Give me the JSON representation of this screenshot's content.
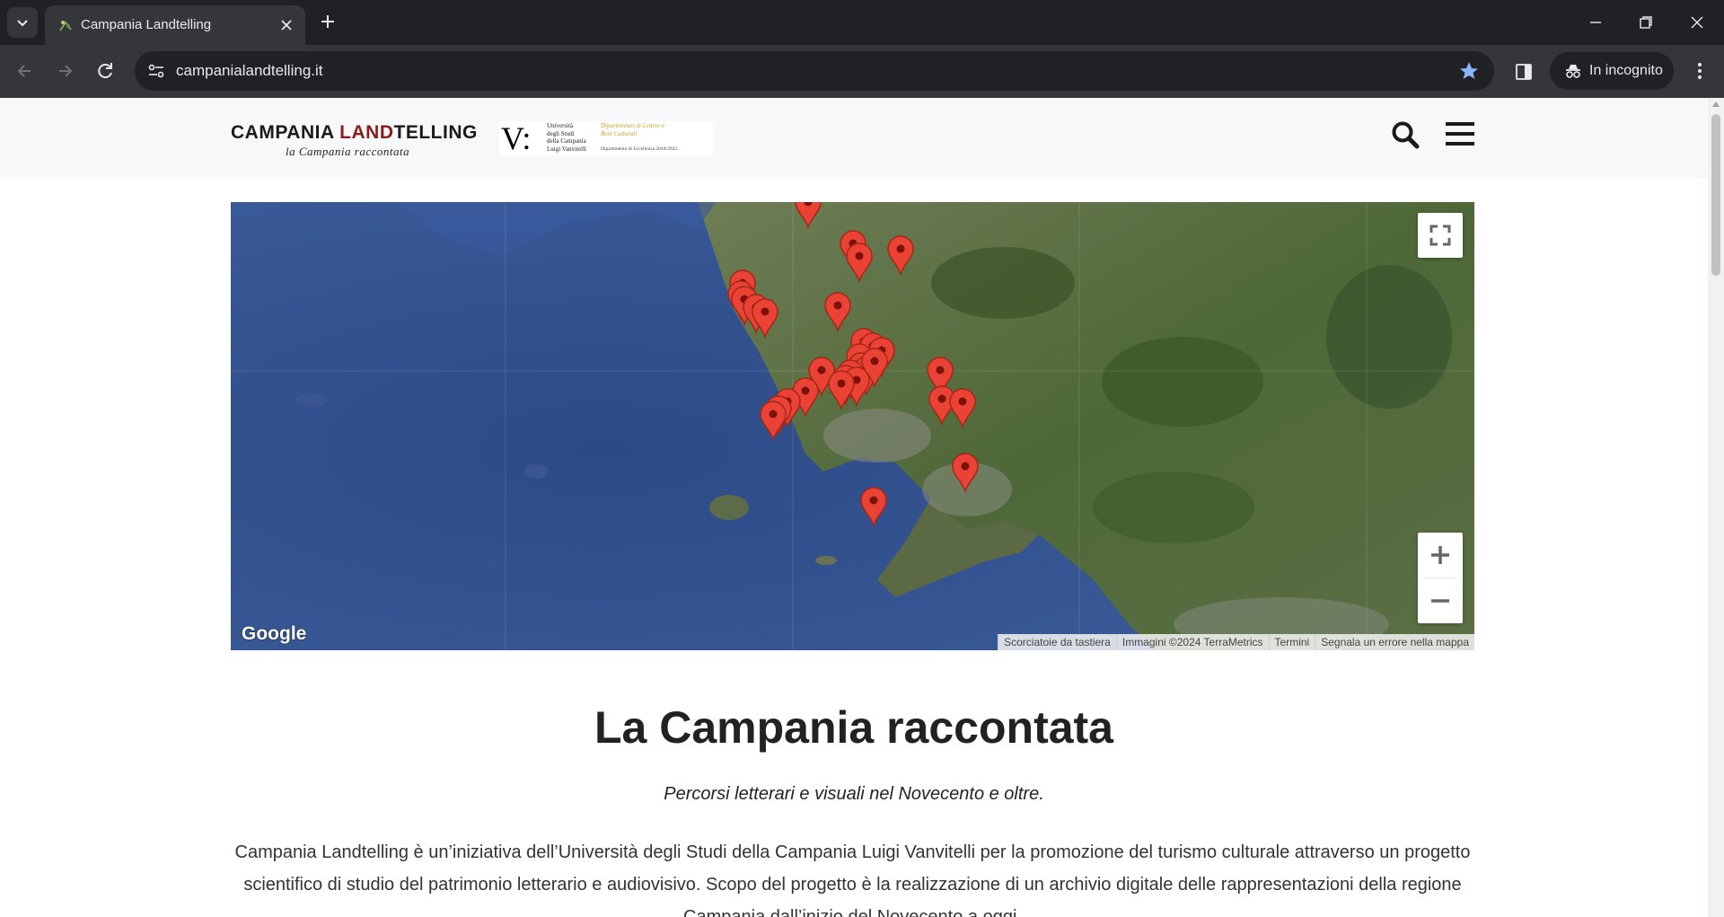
{
  "browser": {
    "tab_title": "Campania Landtelling",
    "url": "campanialandtelling.it",
    "incognito_label": "In incognito"
  },
  "header": {
    "logo_part1": "CAMPANIA ",
    "logo_accent": "LAND",
    "logo_part2": "TELLING",
    "logo_tagline": "la Campania raccontata",
    "uni_mark": "V:",
    "uni_text": "Università\ndegli Studi\ndella Campania\nLuigi Vanvitelli",
    "uni_dept": "Dipartimento di Lettere e\nBeni Culturali",
    "uni_excellence": "Dipartimento di Eccellenza 2018/2022"
  },
  "map": {
    "google_label": "Google",
    "attribution": [
      "Scorciatoie da tastiera",
      "Immagini ©2024 TerraMetrics",
      "Termini",
      "Segnala un errore nella mappa"
    ]
  },
  "content": {
    "title": "La Campania raccontata",
    "subtitle": "Percorsi letterari e visuali nel Novecento e oltre.",
    "intro": "Campania Landtelling è un’iniziativa dell’Università degli Studi della Campania Luigi Vanvitelli per la promozione del turismo culturale attraverso un progetto scientifico di studio del patrimonio letterario e audiovisivo. Scopo del progetto è la realizzazione di un archivio digitale delle rappresentazioni della regione Campania dall’inizio del Novecento a oggi."
  },
  "colors": {
    "brand_accent": "#8b1c1c",
    "marker": "#ea4335",
    "sea": "#2f4d88",
    "land": "#4f6b3a"
  }
}
